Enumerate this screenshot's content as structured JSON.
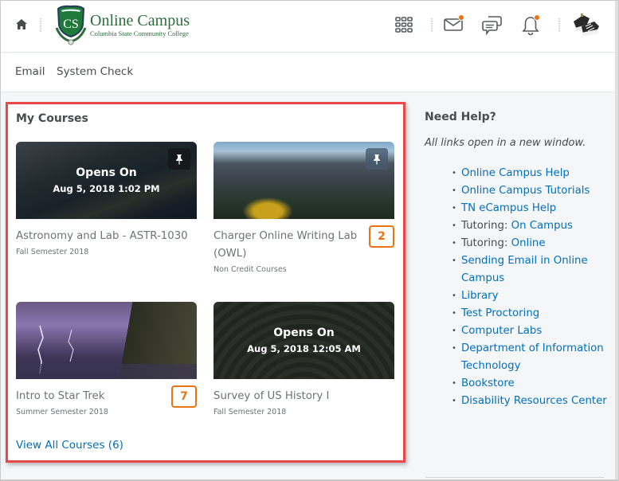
{
  "header": {
    "logo_title": "Online Campus",
    "logo_subtitle": "Columbia State Community College",
    "logo_initials": "CS",
    "icons": [
      "home-icon",
      "apps-grid-icon",
      "mail-icon",
      "chat-icon",
      "bell-icon"
    ],
    "notification_color": "#e87511"
  },
  "nav": {
    "items": [
      "Email",
      "System Check"
    ]
  },
  "my_courses": {
    "title": "My Courses",
    "courses": [
      {
        "name": "Astronomy and Lab - ASTR-1030",
        "semester": "Fall Semester 2018",
        "opens_label": "Opens On",
        "opens_date": "Aug 5, 2018 1:02 PM",
        "pinned": true,
        "image": "coastal-cliffs"
      },
      {
        "name": "Charger Online Writing Lab (OWL)",
        "semester": "Non Credit Courses",
        "badge": "2",
        "pinned": true,
        "image": "mountains"
      },
      {
        "name": "Intro to Star Trek",
        "semester": "Summer Semester 2018",
        "badge": "7",
        "pinned": false,
        "image": "lightning-storm"
      },
      {
        "name": "Survey of US History I",
        "semester": "Fall Semester 2018",
        "opens_label": "Opens On",
        "opens_date": "Aug 5, 2018 12:05 AM",
        "pinned": false,
        "image": "stadium-seats"
      }
    ],
    "view_all": "View All Courses (6)",
    "highlight_color": "#ea4848",
    "badge_color": "#e87511"
  },
  "help": {
    "title": "Need Help?",
    "note": "All links open in a new window.",
    "links": [
      {
        "prefix": "",
        "label": "Online Campus Help"
      },
      {
        "prefix": "",
        "label": "Online Campus Tutorials"
      },
      {
        "prefix": "",
        "label": "TN eCampus Help"
      },
      {
        "prefix": "Tutoring: ",
        "label": "On Campus"
      },
      {
        "prefix": "Tutoring: ",
        "label": "Online"
      },
      {
        "prefix": "",
        "label": "Sending Email in Online Campus"
      },
      {
        "prefix": "",
        "label": "Library"
      },
      {
        "prefix": "",
        "label": "Test Proctoring"
      },
      {
        "prefix": "",
        "label": "Computer Labs"
      },
      {
        "prefix": "",
        "label": "Department of Information Technology"
      },
      {
        "prefix": "",
        "label": "Bookstore"
      },
      {
        "prefix": "",
        "label": "Disability Resources Center"
      }
    ],
    "link_color": "#006fbf"
  }
}
